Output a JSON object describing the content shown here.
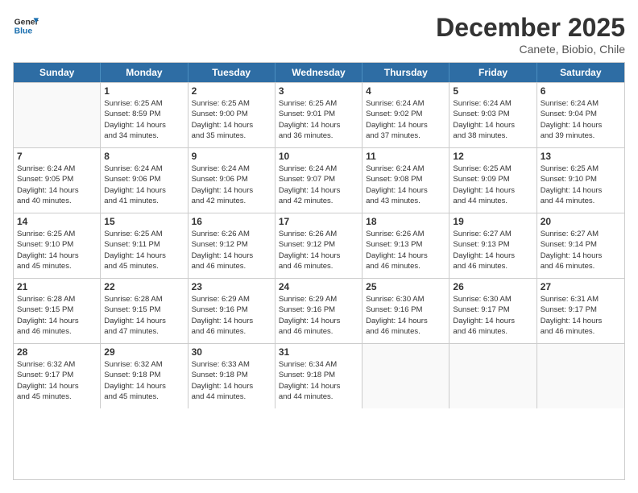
{
  "logo": {
    "line1": "General",
    "line2": "Blue"
  },
  "title": "December 2025",
  "subtitle": "Canete, Biobio, Chile",
  "days_of_week": [
    "Sunday",
    "Monday",
    "Tuesday",
    "Wednesday",
    "Thursday",
    "Friday",
    "Saturday"
  ],
  "weeks": [
    [
      {
        "day": "",
        "empty": true
      },
      {
        "day": "1",
        "sunrise": "Sunrise: 6:25 AM",
        "sunset": "Sunset: 8:59 PM",
        "daylight": "Daylight: 14 hours",
        "daylight2": "and 34 minutes."
      },
      {
        "day": "2",
        "sunrise": "Sunrise: 6:25 AM",
        "sunset": "Sunset: 9:00 PM",
        "daylight": "Daylight: 14 hours",
        "daylight2": "and 35 minutes."
      },
      {
        "day": "3",
        "sunrise": "Sunrise: 6:25 AM",
        "sunset": "Sunset: 9:01 PM",
        "daylight": "Daylight: 14 hours",
        "daylight2": "and 36 minutes."
      },
      {
        "day": "4",
        "sunrise": "Sunrise: 6:24 AM",
        "sunset": "Sunset: 9:02 PM",
        "daylight": "Daylight: 14 hours",
        "daylight2": "and 37 minutes."
      },
      {
        "day": "5",
        "sunrise": "Sunrise: 6:24 AM",
        "sunset": "Sunset: 9:03 PM",
        "daylight": "Daylight: 14 hours",
        "daylight2": "and 38 minutes."
      },
      {
        "day": "6",
        "sunrise": "Sunrise: 6:24 AM",
        "sunset": "Sunset: 9:04 PM",
        "daylight": "Daylight: 14 hours",
        "daylight2": "and 39 minutes."
      }
    ],
    [
      {
        "day": "7",
        "sunrise": "Sunrise: 6:24 AM",
        "sunset": "Sunset: 9:05 PM",
        "daylight": "Daylight: 14 hours",
        "daylight2": "and 40 minutes."
      },
      {
        "day": "8",
        "sunrise": "Sunrise: 6:24 AM",
        "sunset": "Sunset: 9:06 PM",
        "daylight": "Daylight: 14 hours",
        "daylight2": "and 41 minutes."
      },
      {
        "day": "9",
        "sunrise": "Sunrise: 6:24 AM",
        "sunset": "Sunset: 9:06 PM",
        "daylight": "Daylight: 14 hours",
        "daylight2": "and 42 minutes."
      },
      {
        "day": "10",
        "sunrise": "Sunrise: 6:24 AM",
        "sunset": "Sunset: 9:07 PM",
        "daylight": "Daylight: 14 hours",
        "daylight2": "and 42 minutes."
      },
      {
        "day": "11",
        "sunrise": "Sunrise: 6:24 AM",
        "sunset": "Sunset: 9:08 PM",
        "daylight": "Daylight: 14 hours",
        "daylight2": "and 43 minutes."
      },
      {
        "day": "12",
        "sunrise": "Sunrise: 6:25 AM",
        "sunset": "Sunset: 9:09 PM",
        "daylight": "Daylight: 14 hours",
        "daylight2": "and 44 minutes."
      },
      {
        "day": "13",
        "sunrise": "Sunrise: 6:25 AM",
        "sunset": "Sunset: 9:10 PM",
        "daylight": "Daylight: 14 hours",
        "daylight2": "and 44 minutes."
      }
    ],
    [
      {
        "day": "14",
        "sunrise": "Sunrise: 6:25 AM",
        "sunset": "Sunset: 9:10 PM",
        "daylight": "Daylight: 14 hours",
        "daylight2": "and 45 minutes."
      },
      {
        "day": "15",
        "sunrise": "Sunrise: 6:25 AM",
        "sunset": "Sunset: 9:11 PM",
        "daylight": "Daylight: 14 hours",
        "daylight2": "and 45 minutes."
      },
      {
        "day": "16",
        "sunrise": "Sunrise: 6:26 AM",
        "sunset": "Sunset: 9:12 PM",
        "daylight": "Daylight: 14 hours",
        "daylight2": "and 46 minutes."
      },
      {
        "day": "17",
        "sunrise": "Sunrise: 6:26 AM",
        "sunset": "Sunset: 9:12 PM",
        "daylight": "Daylight: 14 hours",
        "daylight2": "and 46 minutes."
      },
      {
        "day": "18",
        "sunrise": "Sunrise: 6:26 AM",
        "sunset": "Sunset: 9:13 PM",
        "daylight": "Daylight: 14 hours",
        "daylight2": "and 46 minutes."
      },
      {
        "day": "19",
        "sunrise": "Sunrise: 6:27 AM",
        "sunset": "Sunset: 9:13 PM",
        "daylight": "Daylight: 14 hours",
        "daylight2": "and 46 minutes."
      },
      {
        "day": "20",
        "sunrise": "Sunrise: 6:27 AM",
        "sunset": "Sunset: 9:14 PM",
        "daylight": "Daylight: 14 hours",
        "daylight2": "and 46 minutes."
      }
    ],
    [
      {
        "day": "21",
        "sunrise": "Sunrise: 6:28 AM",
        "sunset": "Sunset: 9:15 PM",
        "daylight": "Daylight: 14 hours",
        "daylight2": "and 46 minutes."
      },
      {
        "day": "22",
        "sunrise": "Sunrise: 6:28 AM",
        "sunset": "Sunset: 9:15 PM",
        "daylight": "Daylight: 14 hours",
        "daylight2": "and 47 minutes."
      },
      {
        "day": "23",
        "sunrise": "Sunrise: 6:29 AM",
        "sunset": "Sunset: 9:16 PM",
        "daylight": "Daylight: 14 hours",
        "daylight2": "and 46 minutes."
      },
      {
        "day": "24",
        "sunrise": "Sunrise: 6:29 AM",
        "sunset": "Sunset: 9:16 PM",
        "daylight": "Daylight: 14 hours",
        "daylight2": "and 46 minutes."
      },
      {
        "day": "25",
        "sunrise": "Sunrise: 6:30 AM",
        "sunset": "Sunset: 9:16 PM",
        "daylight": "Daylight: 14 hours",
        "daylight2": "and 46 minutes."
      },
      {
        "day": "26",
        "sunrise": "Sunrise: 6:30 AM",
        "sunset": "Sunset: 9:17 PM",
        "daylight": "Daylight: 14 hours",
        "daylight2": "and 46 minutes."
      },
      {
        "day": "27",
        "sunrise": "Sunrise: 6:31 AM",
        "sunset": "Sunset: 9:17 PM",
        "daylight": "Daylight: 14 hours",
        "daylight2": "and 46 minutes."
      }
    ],
    [
      {
        "day": "28",
        "sunrise": "Sunrise: 6:32 AM",
        "sunset": "Sunset: 9:17 PM",
        "daylight": "Daylight: 14 hours",
        "daylight2": "and 45 minutes."
      },
      {
        "day": "29",
        "sunrise": "Sunrise: 6:32 AM",
        "sunset": "Sunset: 9:18 PM",
        "daylight": "Daylight: 14 hours",
        "daylight2": "and 45 minutes."
      },
      {
        "day": "30",
        "sunrise": "Sunrise: 6:33 AM",
        "sunset": "Sunset: 9:18 PM",
        "daylight": "Daylight: 14 hours",
        "daylight2": "and 44 minutes."
      },
      {
        "day": "31",
        "sunrise": "Sunrise: 6:34 AM",
        "sunset": "Sunset: 9:18 PM",
        "daylight": "Daylight: 14 hours",
        "daylight2": "and 44 minutes."
      },
      {
        "day": "",
        "empty": true
      },
      {
        "day": "",
        "empty": true
      },
      {
        "day": "",
        "empty": true
      }
    ]
  ]
}
